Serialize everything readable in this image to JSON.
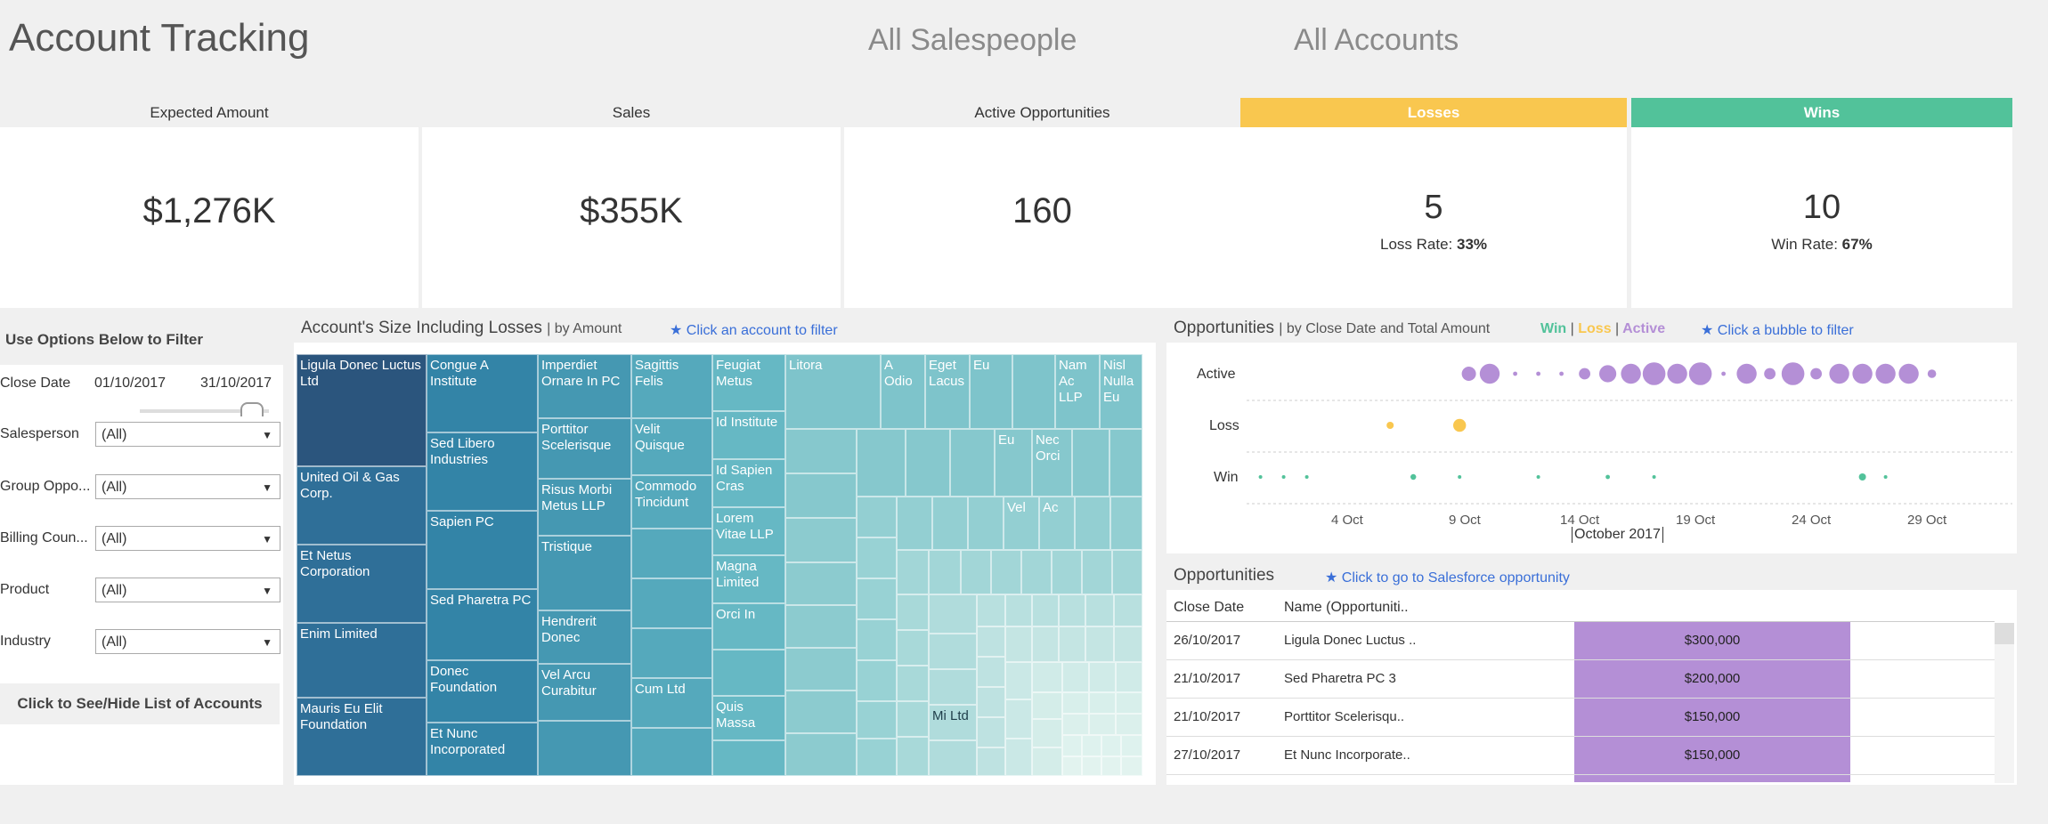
{
  "header": {
    "title": "Account Tracking",
    "salespeople_filter": "All Salespeople",
    "accounts_filter": "All Accounts"
  },
  "kpis": {
    "expected": {
      "label": "Expected Amount",
      "value": "$1,276K"
    },
    "sales": {
      "label": "Sales",
      "value": "$355K"
    },
    "active": {
      "label": "Active Opportunities",
      "value": "160"
    },
    "losses": {
      "label": "Losses",
      "value": "5",
      "rate_label": "Loss Rate:",
      "rate": "33%",
      "color": "#f9c74f"
    },
    "wins": {
      "label": "Wins",
      "value": "10",
      "rate_label": "Win Rate:",
      "rate": "67%",
      "color": "#52c29a"
    }
  },
  "filters": {
    "title": "Use Options Below to Filter",
    "close_date_label": "Close Date",
    "date_from": "01/10/2017",
    "date_to": "31/10/2017",
    "rows": [
      {
        "label": "Salesperson",
        "value": "(All)"
      },
      {
        "label": "Group Oppo...",
        "value": "(All)"
      },
      {
        "label": "Billing Coun...",
        "value": "(All)"
      },
      {
        "label": "Product",
        "value": "(All)"
      },
      {
        "label": "Industry",
        "value": "(All)"
      }
    ],
    "toggle_button": "Click to See/Hide List of Accounts"
  },
  "treemap": {
    "title": "Account's Size Including Losses",
    "subtitle": "| by Amount",
    "hint": "★ Click an account to filter",
    "labels": {
      "ligula": "Ligula Donec Luctus Ltd",
      "united": "United Oil & Gas Corp.",
      "etnetus": "Et Netus Corporation",
      "enim": "Enim Limited",
      "mauris": "Mauris Eu Elit Foundation",
      "congue": "Congue A Institute",
      "sedlibero": "Sed Libero Industries",
      "sapien": "Sapien PC",
      "sedpharetra": "Sed Pharetra PC",
      "donec": "Donec Foundation",
      "etnunc": "Et Nunc Incorporated",
      "imperdiet": "Imperdiet Ornare In PC",
      "porttitor": "Porttitor Scelerisque",
      "risus": "Risus Morbi Metus LLP",
      "tristique": "Tristique",
      "hendrerit": "Hendrerit Donec",
      "velarcu": "Vel Arcu Curabitur",
      "sagittis": "Sagittis Felis",
      "velit": "Velit Quisque",
      "commodo": "Commodo Tincidunt",
      "cum": "Cum Ltd",
      "feugiat": "Feugiat Metus",
      "idinst": "Id Institute",
      "idsapien": "Id Sapien Cras",
      "lorem": "Lorem Vitae LLP",
      "magna": "Magna Limited",
      "orci": "Orci In",
      "quis": "Quis Massa",
      "litora": "Litora",
      "aodio": "A Odio",
      "eget": "Eget Lacus",
      "eu1": "Eu",
      "nam": "Nam Ac LLP",
      "nisl": "Nisl Nulla Eu",
      "eu2": "Eu",
      "nec": "Nec Orci",
      "vel": "Vel",
      "ac": "Ac",
      "mi": "Mi Ltd"
    }
  },
  "opportunities_chart": {
    "title": "Opportunities",
    "subtitle": "| by Close Date and Total Amount",
    "legend_win": "Win",
    "legend_sep1": "|",
    "legend_loss": "Loss",
    "legend_sep2": "|",
    "legend_active": "Active",
    "hint": "★ Click a bubble to filter",
    "rows": [
      "Active",
      "Loss",
      "Win"
    ],
    "x_ticks": [
      "4 Oct",
      "9 Oct",
      "14 Oct",
      "19 Oct",
      "24 Oct",
      "29 Oct"
    ],
    "x_caption": "October 2017",
    "colors": {
      "active": "#b48fd6",
      "loss": "#f9c74f",
      "win": "#52c29a"
    }
  },
  "chart_data": {
    "type": "scatter",
    "xlabel": "October 2017",
    "categories": [
      "Active",
      "Loss",
      "Win"
    ],
    "series": [
      {
        "name": "Active",
        "points": [
          [
            10.6,
            10
          ],
          [
            11.5,
            14
          ],
          [
            12.6,
            3
          ],
          [
            13.6,
            3
          ],
          [
            14.6,
            3
          ],
          [
            15.6,
            8
          ],
          [
            16.6,
            12
          ],
          [
            17.6,
            14
          ],
          [
            18.6,
            16
          ],
          [
            19.6,
            14
          ],
          [
            20.6,
            16
          ],
          [
            21.6,
            3
          ],
          [
            22.6,
            14
          ],
          [
            23.6,
            8
          ],
          [
            24.6,
            16
          ],
          [
            25.6,
            8
          ],
          [
            26.6,
            14
          ],
          [
            27.6,
            14
          ],
          [
            28.6,
            14
          ],
          [
            29.6,
            14
          ],
          [
            30.6,
            6
          ]
        ]
      },
      {
        "name": "Loss",
        "points": [
          [
            7.2,
            5
          ],
          [
            10.2,
            9
          ]
        ]
      },
      {
        "name": "Win",
        "points": [
          [
            1.6,
            1
          ],
          [
            2.6,
            1
          ],
          [
            3.6,
            1
          ],
          [
            8.2,
            4
          ],
          [
            10.2,
            1
          ],
          [
            13.6,
            2
          ],
          [
            16.6,
            3
          ],
          [
            18.6,
            1
          ],
          [
            27.6,
            5
          ],
          [
            28.6,
            1
          ]
        ]
      }
    ]
  },
  "table": {
    "title": "Opportunities",
    "hint": "★ Click to go to Salesforce opportunity",
    "col_date": "Close Date",
    "col_name": "Name (Opportuniti..",
    "rows": [
      {
        "date": "26/10/2017",
        "name": "Ligula Donec Luctus ..",
        "amount": "$300,000"
      },
      {
        "date": "21/10/2017",
        "name": "Sed Pharetra PC 3",
        "amount": "$200,000"
      },
      {
        "date": "21/10/2017",
        "name": "Porttitor Scelerisqu..",
        "amount": "$150,000"
      },
      {
        "date": "27/10/2017",
        "name": "Et Nunc Incorporate..",
        "amount": "$150,000"
      }
    ]
  }
}
